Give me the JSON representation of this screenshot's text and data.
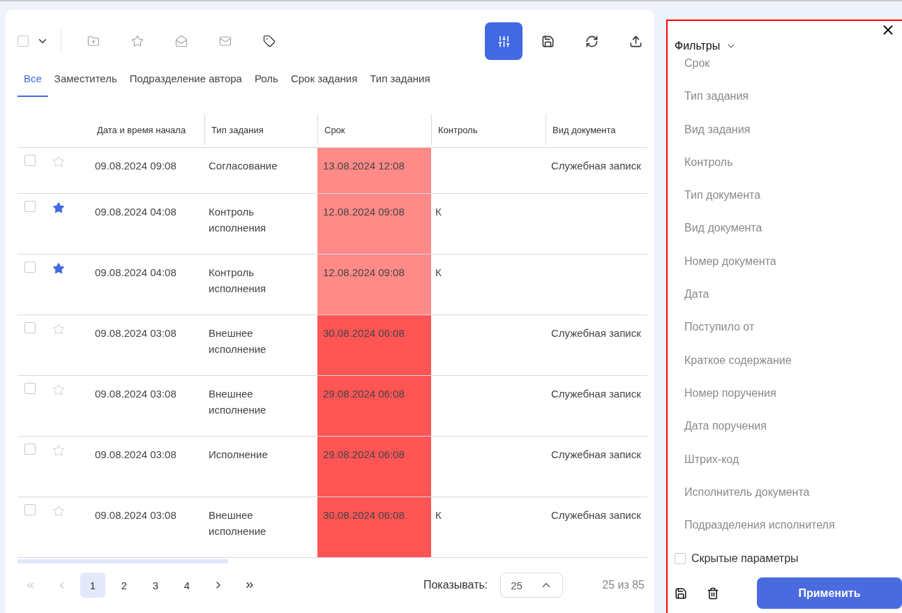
{
  "toolbar": {
    "select_all": {
      "checked": false
    },
    "actions": [
      {
        "kind": "folder",
        "disabled": true
      },
      {
        "kind": "star",
        "disabled": true
      },
      {
        "kind": "mail-open",
        "disabled": true
      },
      {
        "kind": "mail",
        "disabled": true
      },
      {
        "kind": "tag",
        "disabled": false
      }
    ],
    "right_actions": [
      {
        "kind": "filter",
        "selected": true
      },
      {
        "kind": "save",
        "selected": false
      },
      {
        "kind": "refresh",
        "selected": false
      },
      {
        "kind": "upload",
        "selected": false
      }
    ]
  },
  "tabs": [
    {
      "label": "Все",
      "selected": true
    },
    {
      "label": "Заместитель",
      "selected": false
    },
    {
      "label": "Подразделение автора",
      "selected": false
    },
    {
      "label": "Роль",
      "selected": false
    },
    {
      "label": "Срок задания",
      "selected": false
    },
    {
      "label": "Тип задания",
      "selected": false
    }
  ],
  "table": {
    "columns": [
      "Дата и время начала",
      "Тип задания",
      "Срок",
      "Контроль",
      "Вид документа"
    ],
    "rows": [
      {
        "checked": false,
        "starred": false,
        "start": "09.08.2024 09:08",
        "task_type": "Согласование",
        "deadline": "13.08.2024 12:08",
        "color": "#ff8a87",
        "control": "",
        "doc_kind": "Служебная записк",
        "tall": false
      },
      {
        "checked": false,
        "starred": true,
        "start": "09.08.2024 04:08",
        "task_type": "Контроль исполнения",
        "deadline": "12.08.2024 09:08",
        "color": "#ff8a87",
        "control": "К",
        "doc_kind": "",
        "tall": true
      },
      {
        "checked": false,
        "starred": true,
        "start": "09.08.2024 04:08",
        "task_type": "Контроль исполнения",
        "deadline": "12.08.2024 09:08",
        "color": "#ff8a87",
        "control": "К",
        "doc_kind": "",
        "tall": true
      },
      {
        "checked": false,
        "starred": false,
        "start": "09.08.2024 03:08",
        "task_type": "Внешнее исполнение",
        "deadline": "30.08.2024 06:08",
        "color": "#ff5555",
        "control": "",
        "doc_kind": "Служебная записк",
        "tall": true
      },
      {
        "checked": false,
        "starred": false,
        "start": "09.08.2024 03:08",
        "task_type": "Внешнее исполнение",
        "deadline": "29.08.2024 06:08",
        "color": "#ff5555",
        "control": "",
        "doc_kind": "Служебная записк",
        "tall": true
      },
      {
        "checked": false,
        "starred": false,
        "start": "09.08.2024 03:08",
        "task_type": "Исполнение",
        "deadline": "29.08.2024 06:08",
        "color": "#ff5555",
        "control": "",
        "doc_kind": "Служебная записк",
        "tall": true
      },
      {
        "checked": false,
        "starred": false,
        "start": "09.08.2024 03:08",
        "task_type": "Внешнее исполнение",
        "deadline": "30.08.2024 06:08",
        "color": "#ff5555",
        "control": "К",
        "doc_kind": "Служебная записк",
        "tall": true
      }
    ]
  },
  "pagination": {
    "first": {
      "disabled": true
    },
    "prev": {
      "disabled": true
    },
    "pages": [
      {
        "label": "1",
        "selected": true
      },
      {
        "label": "2",
        "selected": false
      },
      {
        "label": "3",
        "selected": false
      },
      {
        "label": "4",
        "selected": false
      }
    ],
    "next": {
      "disabled": false
    },
    "last": {
      "disabled": false
    },
    "page_size_label": "Показывать:",
    "page_size": "25",
    "count": "25 из 85"
  },
  "filters": {
    "title": "Фильтры",
    "expanded": true,
    "items": [
      "Срок",
      "Тип задания",
      "Вид задания",
      "Контроль",
      "Тип документа",
      "Вид документа",
      "Номер документа",
      "Дата",
      "Поступило от",
      "Краткое содержание",
      "Номер поручения",
      "Дата поручения",
      "Штрих-код",
      "Исполнитель документа",
      "Подразделения исполнителя"
    ],
    "hidden_params": {
      "label": "Скрытые параметры",
      "checked": false
    },
    "apply": "Применить"
  }
}
